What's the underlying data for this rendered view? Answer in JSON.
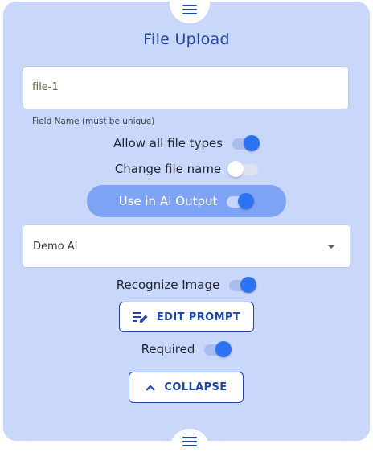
{
  "title": "File Upload",
  "field_name": {
    "value": "file-1",
    "helper": "Field Name (must be unique)"
  },
  "toggles": {
    "allow_all_types": {
      "label": "Allow all file types",
      "on": true
    },
    "change_file_name": {
      "label": "Change file name",
      "on": false
    },
    "use_in_ai_output": {
      "label": "Use in AI Output",
      "on": true
    },
    "recognize_image": {
      "label": "Recognize Image",
      "on": true
    },
    "required": {
      "label": "Required",
      "on": true
    }
  },
  "model_select": {
    "value": "Demo AI"
  },
  "buttons": {
    "edit_prompt": "EDIT PROMPT",
    "collapse": "COLLAPSE"
  },
  "icons": {
    "drag_handle": "menu-icon",
    "edit_prompt": "edit-note-icon",
    "collapse": "chevron-up-icon",
    "dropdown": "caret-down-icon"
  },
  "colors": {
    "card_bg": "#c9d7fb",
    "accent": "#2d72f2",
    "primary_text": "#2445a6",
    "ai_pill": "#7ea2f4"
  }
}
